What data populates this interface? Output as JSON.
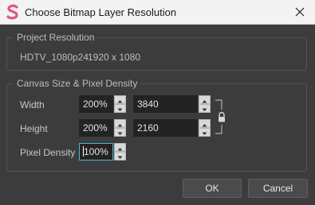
{
  "window": {
    "title": "Choose Bitmap Layer Resolution",
    "app_icon": "app-logo-s",
    "close_icon": "close-icon"
  },
  "project_resolution": {
    "legend": "Project Resolution",
    "format": "HDTV_1080p24",
    "size": "1920 x 1080"
  },
  "canvas": {
    "legend": "Canvas Size & Pixel Density",
    "width": {
      "label": "Width",
      "percent": "200%",
      "pixels": "3840"
    },
    "height": {
      "label": "Height",
      "percent": "200%",
      "pixels": "2160"
    },
    "pixel_density": {
      "label": "Pixel Density",
      "value": "100%"
    },
    "link_icon": "lock-icon"
  },
  "buttons": {
    "ok": "OK",
    "cancel": "Cancel"
  },
  "colors": {
    "background": "#3c3c3c",
    "titlebar": "#f3f3f3",
    "accent": "#e0568a",
    "focus_border": "#47b7d6"
  }
}
